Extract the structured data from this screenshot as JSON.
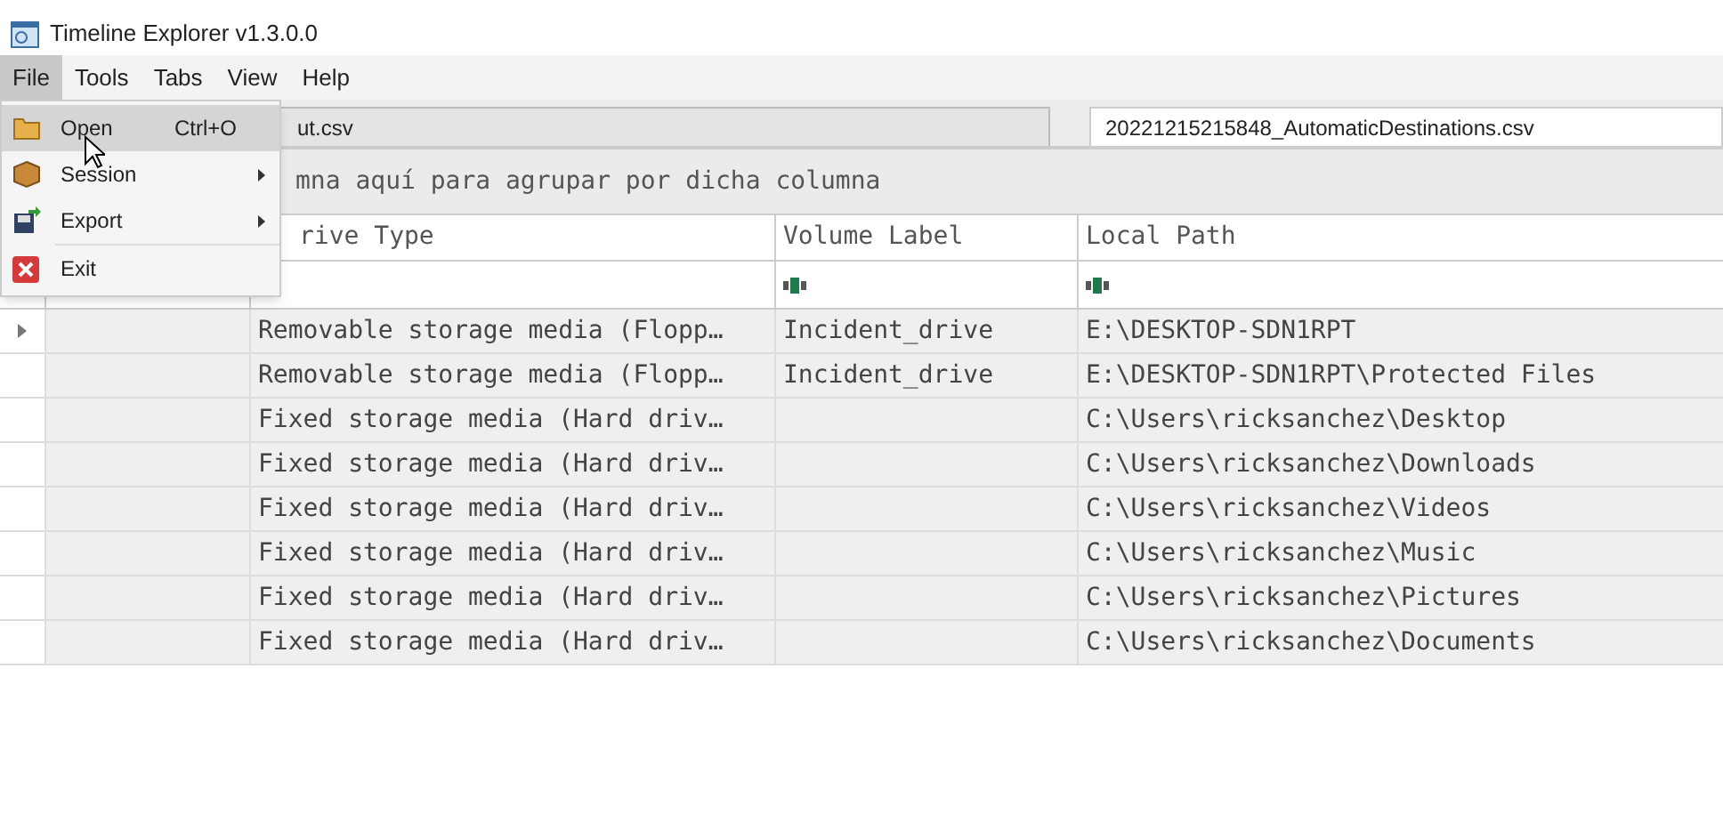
{
  "window": {
    "title": "Timeline Explorer v1.3.0.0"
  },
  "menu_bar": [
    {
      "label": "File",
      "selected": true
    },
    {
      "label": "Tools",
      "selected": false
    },
    {
      "label": "Tabs",
      "selected": false
    },
    {
      "label": "View",
      "selected": false
    },
    {
      "label": "Help",
      "selected": false
    }
  ],
  "file_menu": [
    {
      "label": "Open",
      "shortcut": "Ctrl+O",
      "submenu": false,
      "selected": true
    },
    {
      "label": "Session",
      "submenu": true,
      "selected": false
    },
    {
      "label": "Export",
      "submenu": true,
      "selected": false
    },
    {
      "label": "Exit",
      "submenu": false,
      "selected": false
    }
  ],
  "tabs": [
    {
      "label": "ut.csv",
      "selected": true
    },
    {
      "label": "20221215215848_AutomaticDestinations.csv",
      "selected": false
    }
  ],
  "group_panel": {
    "text": "mna aquí para agrupar por dicha columna"
  },
  "table": {
    "columns": [
      "",
      "rive Type",
      "Volume Label",
      "Local Path"
    ],
    "filters": [
      false,
      false,
      true,
      true
    ],
    "rows": [
      {
        "expandable": true,
        "cells": [
          "",
          "Removable storage media (Flopp…",
          "Incident_drive",
          "E:\\DESKTOP-SDN1RPT"
        ]
      },
      {
        "expandable": false,
        "cells": [
          "",
          "Removable storage media (Flopp…",
          "Incident_drive",
          "E:\\DESKTOP-SDN1RPT\\Protected Files"
        ]
      },
      {
        "expandable": false,
        "cells": [
          "",
          "Fixed storage media (Hard driv…",
          "",
          "C:\\Users\\ricksanchez\\Desktop"
        ]
      },
      {
        "expandable": false,
        "cells": [
          "",
          "Fixed storage media (Hard driv…",
          "",
          "C:\\Users\\ricksanchez\\Downloads"
        ]
      },
      {
        "expandable": false,
        "cells": [
          "",
          "Fixed storage media (Hard driv…",
          "",
          "C:\\Users\\ricksanchez\\Videos"
        ]
      },
      {
        "expandable": false,
        "cells": [
          "",
          "Fixed storage media (Hard driv…",
          "",
          "C:\\Users\\ricksanchez\\Music"
        ]
      },
      {
        "expandable": false,
        "cells": [
          "",
          "Fixed storage media (Hard driv…",
          "",
          "C:\\Users\\ricksanchez\\Pictures"
        ]
      },
      {
        "expandable": false,
        "cells": [
          "",
          "Fixed storage media (Hard driv…",
          "",
          "C:\\Users\\ricksanchez\\Documents"
        ]
      }
    ]
  }
}
